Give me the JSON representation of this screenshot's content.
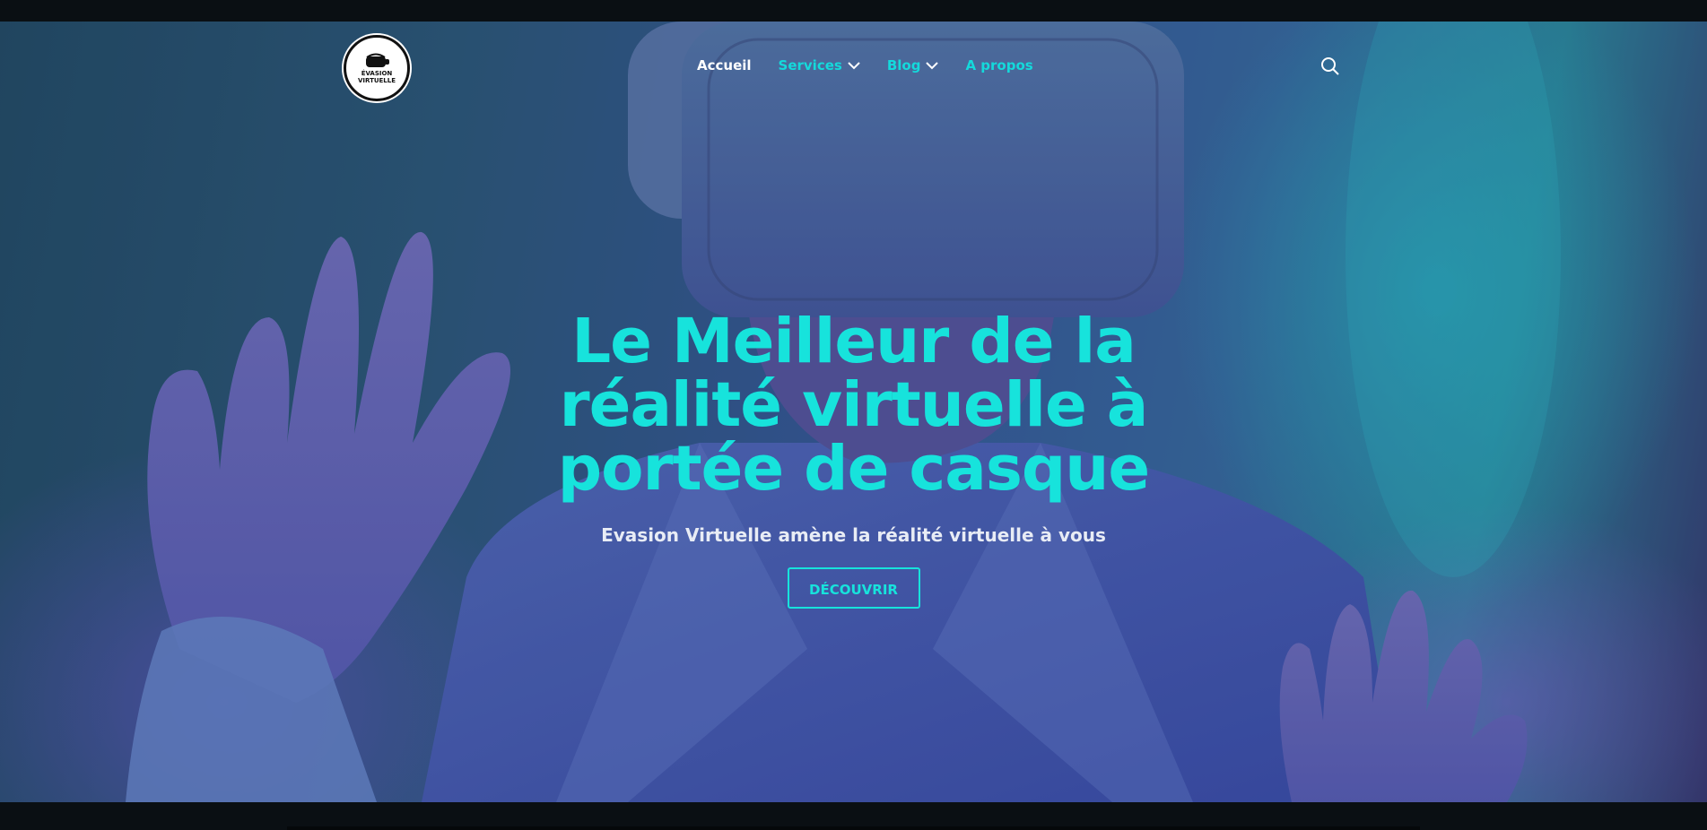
{
  "logo": {
    "line1": "ÉVASION",
    "line2": "VIRTUELLE"
  },
  "nav": {
    "items": [
      {
        "label": "Accueil",
        "dropdown": false,
        "active": true
      },
      {
        "label": "Services",
        "dropdown": true,
        "active": false
      },
      {
        "label": "Blog",
        "dropdown": true,
        "active": false
      },
      {
        "label": "A propos",
        "dropdown": false,
        "active": false
      }
    ],
    "search_icon": "search-icon"
  },
  "hero": {
    "title": "Le Meilleur de la réalité virtuelle à portée de casque",
    "subtitle": "Evasion Virtuelle amène la réalité virtuelle à vous",
    "cta_label": "DÉCOUVRIR"
  },
  "colors": {
    "accent": "#17e3dc",
    "nav_active": "#ffffff",
    "bar": "#0a0f13"
  }
}
